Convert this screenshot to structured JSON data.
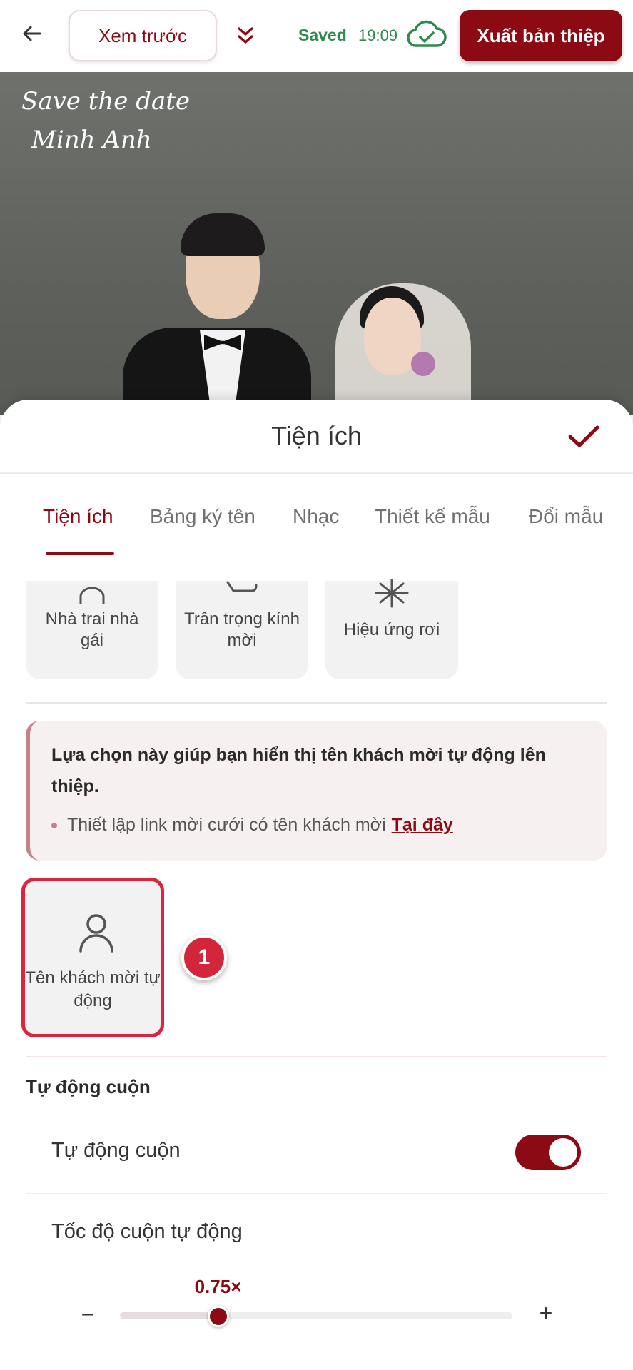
{
  "toolbar": {
    "preview_label": "Xem trước",
    "saved_label": "Saved",
    "saved_time": "19:09",
    "export_label": "Xuất bản thiệp",
    "icons": [
      "back-arrow-icon",
      "double-chevron-down-icon",
      "cloud-check-icon"
    ]
  },
  "photo": {
    "signature_line1": "Save the date",
    "signature_line2": "Minh Anh"
  },
  "sheet": {
    "title": "Tiện ích",
    "tabs": [
      {
        "label": "Tiện ích",
        "active": true
      },
      {
        "label": "Bảng ký tên",
        "active": false
      },
      {
        "label": "Nhạc",
        "active": false
      },
      {
        "label": "Thiết kế mẫu",
        "active": false
      },
      {
        "label": "Đổi mẫu",
        "active": false
      }
    ],
    "feature_cards": [
      {
        "label": "Nhà trai nhà gái"
      },
      {
        "label": "Trân trọng kính mời"
      },
      {
        "label": "Hiệu ứng rơi"
      }
    ],
    "info": {
      "title": "Lựa chọn này giúp bạn hiển thị tên khách mời tự động lên thiệp.",
      "bullet_text": "Thiết lập link mời cưới có tên khách mời",
      "bullet_link": "Tại đây"
    },
    "guest_card": {
      "label": "Tên khách mời tự động",
      "selected": true
    },
    "step_badge": "1",
    "autoscroll": {
      "section_title": "Tự động cuộn",
      "toggle_label": "Tự động cuộn",
      "toggle_on": true,
      "speed_label": "Tốc độ cuộn tự động",
      "speed_value": "0.75×",
      "speed_fraction": 0.25,
      "minus_label": "−",
      "plus_label": "+"
    }
  },
  "colors": {
    "brand": "#8b0a14",
    "saved_green": "#2e8b4e",
    "highlight_red": "#d9253d"
  }
}
